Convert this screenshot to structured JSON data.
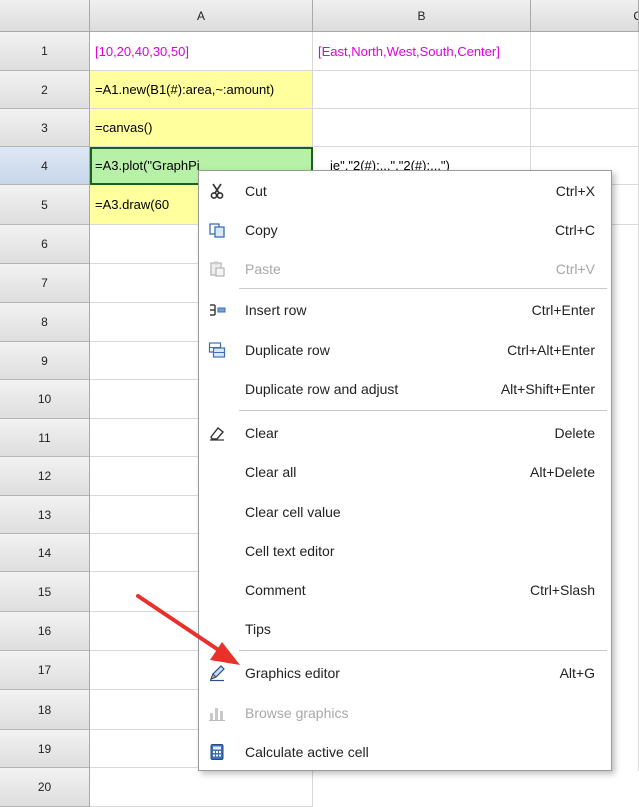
{
  "columns": [
    "A",
    "B",
    "C"
  ],
  "rows": [
    "1",
    "2",
    "3",
    "4",
    "5",
    "6",
    "7",
    "8",
    "9",
    "10",
    "11",
    "12",
    "13",
    "14",
    "15",
    "16",
    "17",
    "18",
    "19",
    "20"
  ],
  "cells": {
    "a1": "[10,20,40,30,50]",
    "b1": "[East,North,West,South,Center]",
    "a2": "=A1.new(B1(#):area,~:amount)",
    "a3": "=canvas()",
    "a4": "=A3.plot(\"GraphPi",
    "a4_overflow": "ie\",\"2(#):...\",\"2(#):...\")",
    "a5": "=A3.draw(60"
  },
  "menu": {
    "cut": {
      "label": "Cut",
      "shortcut": "Ctrl+X"
    },
    "copy": {
      "label": "Copy",
      "shortcut": "Ctrl+C"
    },
    "paste": {
      "label": "Paste",
      "shortcut": "Ctrl+V"
    },
    "insert_row": {
      "label": "Insert row",
      "shortcut": "Ctrl+Enter"
    },
    "duplicate_row": {
      "label": "Duplicate row",
      "shortcut": "Ctrl+Alt+Enter"
    },
    "duplicate_row_adjust": {
      "label": "Duplicate row and adjust",
      "shortcut": "Alt+Shift+Enter"
    },
    "clear": {
      "label": "Clear",
      "shortcut": "Delete"
    },
    "clear_all": {
      "label": "Clear all",
      "shortcut": "Alt+Delete"
    },
    "clear_cell_value": {
      "label": "Clear cell value"
    },
    "cell_text_editor": {
      "label": "Cell text editor"
    },
    "comment": {
      "label": "Comment",
      "shortcut": "Ctrl+Slash"
    },
    "tips": {
      "label": "Tips"
    },
    "graphics_editor": {
      "label": "Graphics editor",
      "shortcut": "Alt+G"
    },
    "browse_graphics": {
      "label": "Browse graphics"
    },
    "calculate_active_cell": {
      "label": "Calculate active cell"
    }
  },
  "colors": {
    "constant_text": "#e000e0",
    "formula_cell_bg": "#ffff9d",
    "active_cell_bg": "#b7f0a7",
    "arrow": "#e8312a"
  },
  "icons": {
    "cut": "scissors-icon",
    "copy": "copy-icon",
    "paste": "paste-icon",
    "insert_row": "insert-row-icon",
    "duplicate_row": "duplicate-row-icon",
    "clear": "eraser-icon",
    "graphics_editor": "graphics-editor-icon",
    "browse_graphics": "bar-chart-icon",
    "calculate_active_cell": "calculator-icon"
  }
}
